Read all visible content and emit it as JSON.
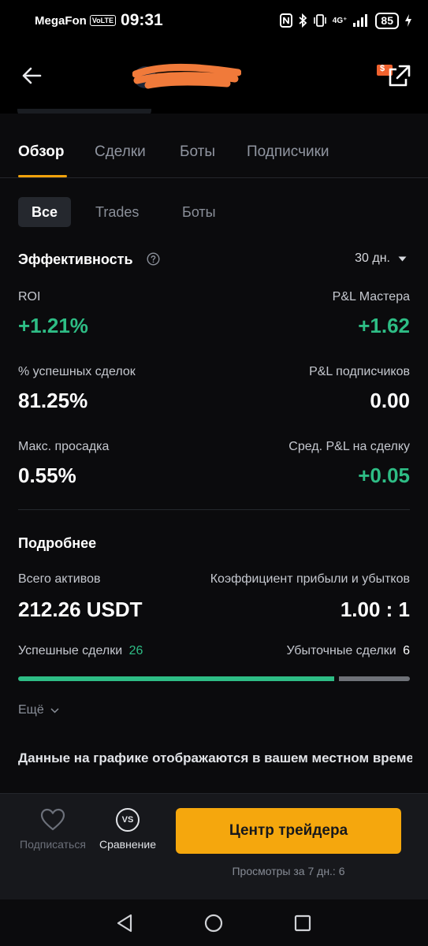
{
  "status_bar": {
    "carrier": "MegaFon",
    "volte": "VoLTE",
    "time": "09:31",
    "network": "4G⁺",
    "battery": "85"
  },
  "header": {
    "back_icon": "arrow-left-icon",
    "share_icon": "external-link-icon",
    "coupon_badge": "$"
  },
  "tabs": [
    {
      "label": "Обзор",
      "active": true
    },
    {
      "label": "Сделки",
      "active": false
    },
    {
      "label": "Боты",
      "active": false
    },
    {
      "label": "Подписчики",
      "active": false
    }
  ],
  "filter_pills": [
    {
      "label": "Все",
      "active": true
    },
    {
      "label": "Trades",
      "active": false
    },
    {
      "label": "Боты",
      "active": false
    }
  ],
  "performance": {
    "title": "Эффективность",
    "period": "30 дн.",
    "metrics": {
      "roi_label": "ROI",
      "roi_value": "+1.21%",
      "pnl_master_label": "P&L Мастера",
      "pnl_master_value": "+1.62",
      "win_rate_label": "% успешных сделок",
      "win_rate_value": "81.25%",
      "pnl_subscribers_label": "P&L подписчиков",
      "pnl_subscribers_value": "0.00",
      "max_drawdown_label": "Макс. просадка",
      "max_drawdown_value": "0.55%",
      "avg_pnl_label": "Сред. P&L на сделку",
      "avg_pnl_value": "+0.05"
    }
  },
  "details": {
    "title": "Подробнее",
    "total_assets_label": "Всего активов",
    "total_assets_value": "212.26 USDT",
    "profit_loss_ratio_label": "Коэффициент прибыли и убытков",
    "profit_loss_ratio_value": "1.00 : 1",
    "winning_trades_label": "Успешные сделки",
    "winning_trades_count": "26",
    "losing_trades_label": "Убыточные сделки",
    "losing_trades_count": "6",
    "win_fraction": 0.8125,
    "more_label": "Ещё"
  },
  "note": "Данные на графике отображаются в вашем местном времени",
  "bottom_bar": {
    "subscribe_label": "Подписаться",
    "compare_label": "Сравнение",
    "compare_icon_text": "VS",
    "cta_label": "Центр трейдера",
    "views_text": "Просмотры за 7 дн.: 6"
  },
  "colors": {
    "accent": "#f5a70d",
    "positive": "#2ebd85",
    "background": "#0b0b0d",
    "redaction_scribble": "#f07a3a"
  }
}
